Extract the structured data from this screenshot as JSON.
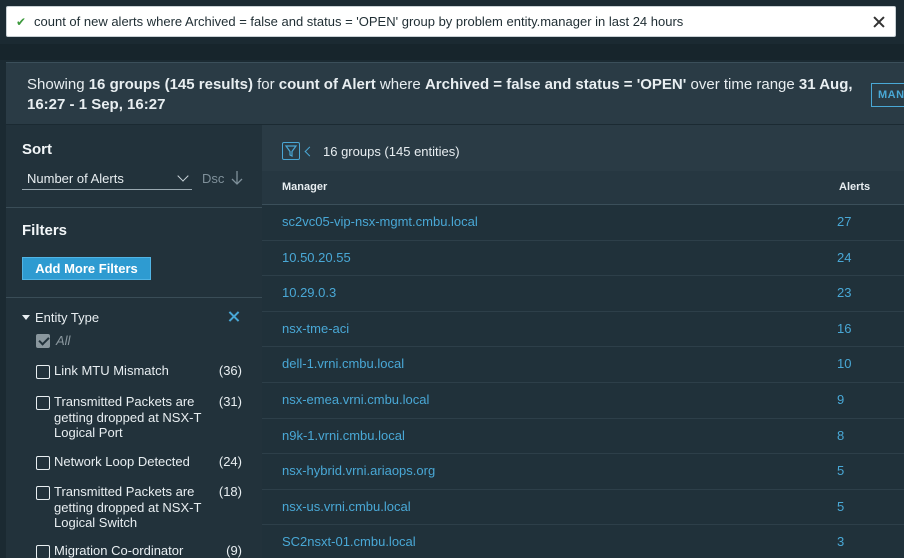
{
  "search": {
    "query": "count of new alerts where Archived = false and status = 'OPEN' group by problem entity.manager in last 24 hours"
  },
  "summary": {
    "prefix": "Showing ",
    "groups_bold": "16 groups",
    "results_bold": "(145 results)",
    "mid1": " for ",
    "metric_bold": "count of Alert",
    "mid2": " where ",
    "condition_bold": "Archived = false and status = 'OPEN'",
    "mid3": " over time range ",
    "range_bold": "31 Aug, 16:27 - 1 Sep, 16:27",
    "manage_label": "MAN"
  },
  "sort": {
    "title": "Sort",
    "selected": "Number of Alerts",
    "order_label": "Dsc"
  },
  "filters": {
    "title": "Filters",
    "add_button": "Add More Filters",
    "entity_type": {
      "label": "Entity Type",
      "all_label": "All",
      "items": [
        {
          "label": "Link MTU Mismatch",
          "count": "(36)"
        },
        {
          "label": "Transmitted Packets are getting dropped at NSX-T Logical Port",
          "count": "(31)"
        },
        {
          "label": "Network Loop Detected",
          "count": "(24)"
        },
        {
          "label": "Transmitted Packets are getting dropped at NSX-T Logical Switch",
          "count": "(18)"
        },
        {
          "label": "Migration Co-ordinator",
          "count": "(9)"
        }
      ]
    }
  },
  "table": {
    "group_count": "16 groups (145 entities)",
    "headers": {
      "manager": "Manager",
      "alerts": "Alerts"
    },
    "rows": [
      {
        "manager": "sc2vc05-vip-nsx-mgmt.cmbu.local",
        "alerts": "27"
      },
      {
        "manager": "10.50.20.55",
        "alerts": "24"
      },
      {
        "manager": "10.29.0.3",
        "alerts": "23"
      },
      {
        "manager": "nsx-tme-aci",
        "alerts": "16"
      },
      {
        "manager": "dell-1.vrni.cmbu.local",
        "alerts": "10"
      },
      {
        "manager": "nsx-emea.vrni.cmbu.local",
        "alerts": "9"
      },
      {
        "manager": "n9k-1.vrni.cmbu.local",
        "alerts": "8"
      },
      {
        "manager": "nsx-hybrid.vrni.ariaops.org",
        "alerts": "5"
      },
      {
        "manager": "nsx-us.vrni.cmbu.local",
        "alerts": "5"
      },
      {
        "manager": "SC2nsxt-01.cmbu.local",
        "alerts": "3"
      }
    ]
  },
  "colors": {
    "accent": "#49a8d6",
    "button": "#2e9bd1",
    "panel": "#22323b",
    "success": "#3d9a3d"
  }
}
